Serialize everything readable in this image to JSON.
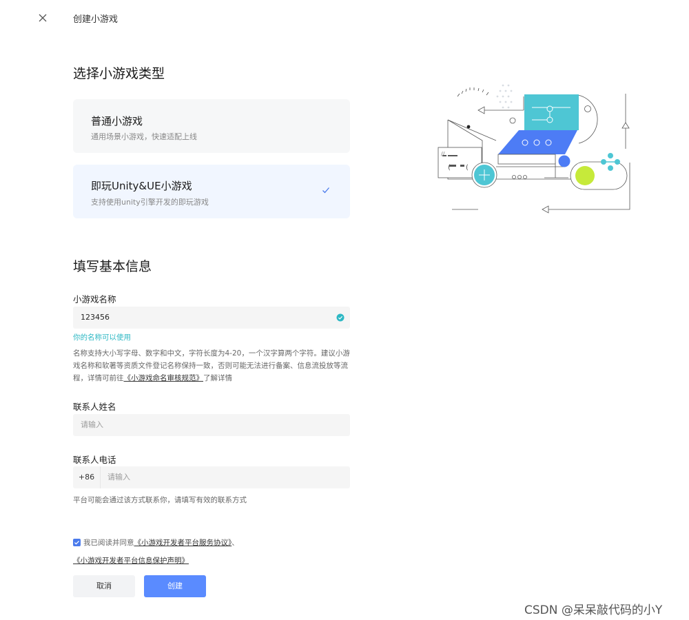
{
  "header": {
    "title": "创建小游戏",
    "close_icon": "close-icon"
  },
  "game_type": {
    "section_title": "选择小游戏类型",
    "options": [
      {
        "title": "普通小游戏",
        "desc": "通用场景小游戏，快速适配上线",
        "selected": false
      },
      {
        "title": "即玩Unity&UE小游戏",
        "desc": "支持使用unity引擎开发的即玩游戏",
        "selected": true
      }
    ]
  },
  "basic_info": {
    "section_title": "填写基本信息",
    "name_label": "小游戏名称",
    "name_value": "123456",
    "name_success": "你的名称可以使用",
    "name_hint_prefix": "名称支持大小写字母、数字和中文，字符长度为4-20，一个汉字算两个字符。建议小游戏名称和软著等资质文件登记名称保持一致，否则可能无法进行备案、信息流投放等流程，详情可前往",
    "name_hint_link": "《小游戏命名审核规范》",
    "name_hint_suffix": "了解详情",
    "contact_name_label": "联系人姓名",
    "contact_name_placeholder": "请输入",
    "contact_phone_label": "联系人电话",
    "phone_prefix": "+86",
    "contact_phone_placeholder": "请输入",
    "phone_hint": "平台可能会通过该方式联系你，请填写有效的联系方式"
  },
  "agreement": {
    "checked": true,
    "prefix": "我已阅读并同意",
    "link1": "《小游戏开发者平台服务协议》",
    "separator": "、",
    "link2": "《小游戏开发者平台信息保护声明》"
  },
  "actions": {
    "cancel_label": "取消",
    "create_label": "创建"
  },
  "watermark": "CSDN @呆呆敲代码的小Y",
  "colors": {
    "accent": "#5a8bff",
    "teal": "#2eb8c4",
    "lime": "#c6ea3a",
    "illustration_teal": "#4ec6d4",
    "illustration_blue": "#4d7cf5"
  }
}
